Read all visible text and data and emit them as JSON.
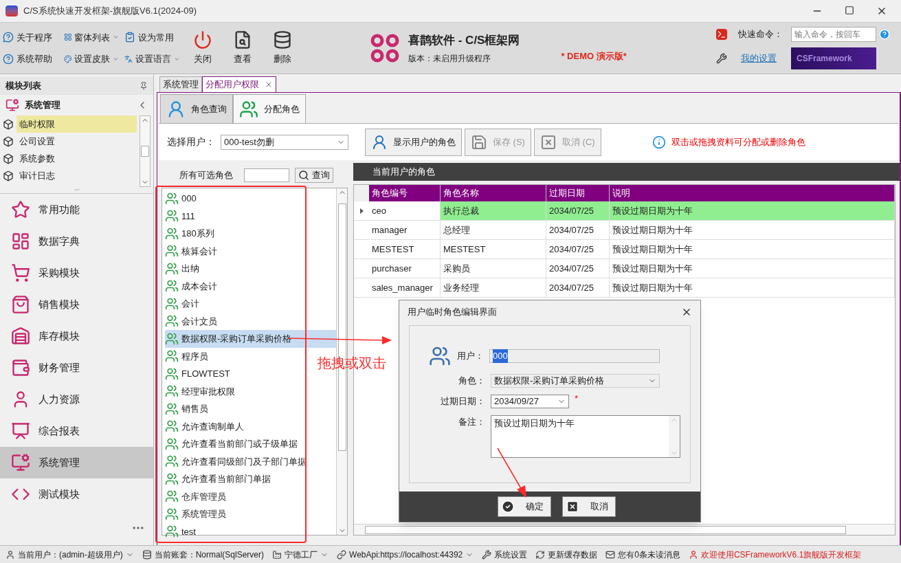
{
  "window": {
    "title": "C/S系统快速开发框架-旗舰版V6.1(2024-09)"
  },
  "ribbon": {
    "small_buttons": [
      {
        "label": "关于程序",
        "dropdown": false
      },
      {
        "label": "窗体列表",
        "dropdown": true
      },
      {
        "label": "设为常用",
        "dropdown": false
      },
      {
        "label": "系统帮助",
        "dropdown": false
      },
      {
        "label": "设置皮肤",
        "dropdown": true
      },
      {
        "label": "设置语言",
        "dropdown": true
      }
    ],
    "large_buttons": [
      {
        "label": "关闭"
      },
      {
        "label": "查看"
      },
      {
        "label": "删除"
      }
    ],
    "brand": {
      "name": "喜鹊软件 - C/S框架网",
      "version": "版本：未启用升级程序",
      "demo": "* DEMO 演示版*"
    },
    "quick_command": {
      "label": "快速命令：",
      "placeholder": "输入命令，按回车"
    },
    "my_settings": "我的设置",
    "banner": "CSFramework"
  },
  "sidebar": {
    "title": "模块列表",
    "group": "系统管理",
    "sub_items": [
      {
        "label": "临时权限",
        "selected": true
      },
      {
        "label": "公司设置",
        "selected": false
      },
      {
        "label": "系统参数",
        "selected": false
      },
      {
        "label": "审计日志",
        "selected": false
      }
    ],
    "nav_items": [
      {
        "label": "常用功能",
        "selected": false
      },
      {
        "label": "数据字典",
        "selected": false
      },
      {
        "label": "采购模块",
        "selected": false
      },
      {
        "label": "销售模块",
        "selected": false
      },
      {
        "label": "库存模块",
        "selected": false
      },
      {
        "label": "财务管理",
        "selected": false
      },
      {
        "label": "人力资源",
        "selected": false
      },
      {
        "label": "综合报表",
        "selected": false
      },
      {
        "label": "系统管理",
        "selected": true
      },
      {
        "label": "测试模块",
        "selected": false
      }
    ]
  },
  "doc_tabs": [
    {
      "label": "系统管理",
      "selected": false,
      "closable": false
    },
    {
      "label": "分配用户权限",
      "selected": true,
      "closable": true
    }
  ],
  "sub_tabs": [
    {
      "label": "角色查询",
      "selected": false
    },
    {
      "label": "分配角色",
      "selected": true
    }
  ],
  "toolbar": {
    "user_label": "选择用户：",
    "user_value": "000-test勿删",
    "buttons": [
      {
        "label": "显示用户的角色",
        "disabled": false
      },
      {
        "label": "保存 (S)",
        "disabled": true
      },
      {
        "label": "取消 (C)",
        "disabled": true
      }
    ],
    "hint": "双击或拖拽资料可分配或删除角色"
  },
  "roles_panel": {
    "label": "所有可选角色",
    "search_button": "查询",
    "items": [
      {
        "label": "000",
        "selected": false
      },
      {
        "label": "111",
        "selected": false
      },
      {
        "label": "180系列",
        "selected": false
      },
      {
        "label": "核算会计",
        "selected": false
      },
      {
        "label": "出纳",
        "selected": false
      },
      {
        "label": "成本会计",
        "selected": false
      },
      {
        "label": "会计",
        "selected": false
      },
      {
        "label": "会计文员",
        "selected": false
      },
      {
        "label": "数据权限-采购订单采购价格",
        "selected": true
      },
      {
        "label": "程序员",
        "selected": false
      },
      {
        "label": "FLOWTEST",
        "selected": false
      },
      {
        "label": "经理审批权限",
        "selected": false
      },
      {
        "label": "销售员",
        "selected": false
      },
      {
        "label": "允许查询制单人",
        "selected": false
      },
      {
        "label": "允许查看当前部门或子级单据",
        "selected": false
      },
      {
        "label": "允许查看同级部门及子部门单据",
        "selected": false
      },
      {
        "label": "允许查看当前部门单据",
        "selected": false
      },
      {
        "label": "仓库管理员",
        "selected": false
      },
      {
        "label": "系统管理员",
        "selected": false
      },
      {
        "label": "test",
        "selected": false
      }
    ]
  },
  "current_roles": {
    "title": "当前用户的角色",
    "columns": [
      "角色编号",
      "角色名称",
      "过期日期",
      "说明"
    ],
    "rows": [
      {
        "cells": [
          "ceo",
          "执行总裁",
          "2034/07/25",
          "预设过期日期为十年"
        ],
        "selected": true
      },
      {
        "cells": [
          "manager",
          "总经理",
          "2034/07/25",
          "预设过期日期为十年"
        ],
        "selected": false
      },
      {
        "cells": [
          "MESTEST",
          "MESTEST",
          "2034/07/25",
          "预设过期日期为十年"
        ],
        "selected": false
      },
      {
        "cells": [
          "purchaser",
          "采购员",
          "2034/07/25",
          "预设过期日期为十年"
        ],
        "selected": false
      },
      {
        "cells": [
          "sales_manager",
          "业务经理",
          "2034/07/25",
          "预设过期日期为十年"
        ],
        "selected": false
      }
    ]
  },
  "dialog": {
    "title": "用户临时角色编辑界面",
    "user_label": "用户：",
    "user_value": "000",
    "role_label": "角色：",
    "role_value": "数据权限-采购订单采购价格",
    "date_label": "过期日期：",
    "date_value": "2034/09/27",
    "required_mark": "*",
    "note_label": "备注：",
    "note_value": "预设过期日期为十年",
    "ok": "确定",
    "cancel": "取消"
  },
  "annotations": {
    "drag_hint": "拖拽或双击"
  },
  "status_bar": [
    {
      "text": "当前用户：(admin-超级用户)",
      "dropdown": true,
      "alert": false
    },
    {
      "text": "当前账套：Normal(SqlServer)",
      "dropdown": false,
      "alert": false
    },
    {
      "text": "宁德工厂",
      "dropdown": true,
      "alert": false
    },
    {
      "text": "WebApi:https://localhost:44392",
      "dropdown": true,
      "alert": false
    },
    {
      "text": "系统设置",
      "dropdown": false,
      "alert": false
    },
    {
      "text": "更新缓存数据",
      "dropdown": false,
      "alert": false
    },
    {
      "text": "您有0条未读消息",
      "dropdown": false,
      "alert": false
    },
    {
      "text": "欢迎使用CSFrameworkV6.1旗舰版开发框架",
      "dropdown": false,
      "alert": true
    }
  ]
}
